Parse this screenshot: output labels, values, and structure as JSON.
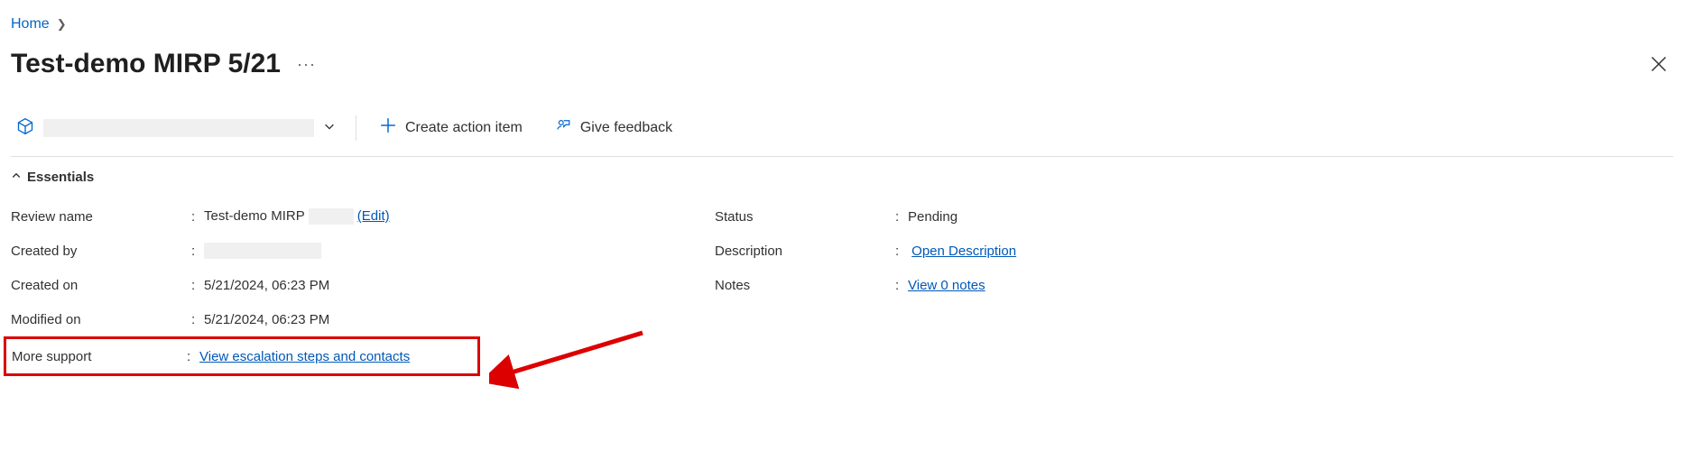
{
  "breadcrumb": {
    "home": "Home"
  },
  "header": {
    "title": "Test-demo MIRP 5/21"
  },
  "toolbar": {
    "create_action_item": "Create action item",
    "give_feedback": "Give feedback"
  },
  "essentials": {
    "heading": "Essentials",
    "left": {
      "review_name": {
        "label": "Review name",
        "value_prefix": "Test-demo MIRP",
        "edit": "(Edit)"
      },
      "created_by": {
        "label": "Created by"
      },
      "created_on": {
        "label": "Created on",
        "value": "5/21/2024, 06:23 PM"
      },
      "modified_on": {
        "label": "Modified on",
        "value": "5/21/2024, 06:23 PM"
      },
      "more_support": {
        "label": "More support",
        "link": "View escalation steps and contacts"
      }
    },
    "right": {
      "status": {
        "label": "Status",
        "value": "Pending"
      },
      "description": {
        "label": "Description",
        "link": "Open Description"
      },
      "notes": {
        "label": "Notes",
        "link": "View 0 notes"
      }
    }
  }
}
